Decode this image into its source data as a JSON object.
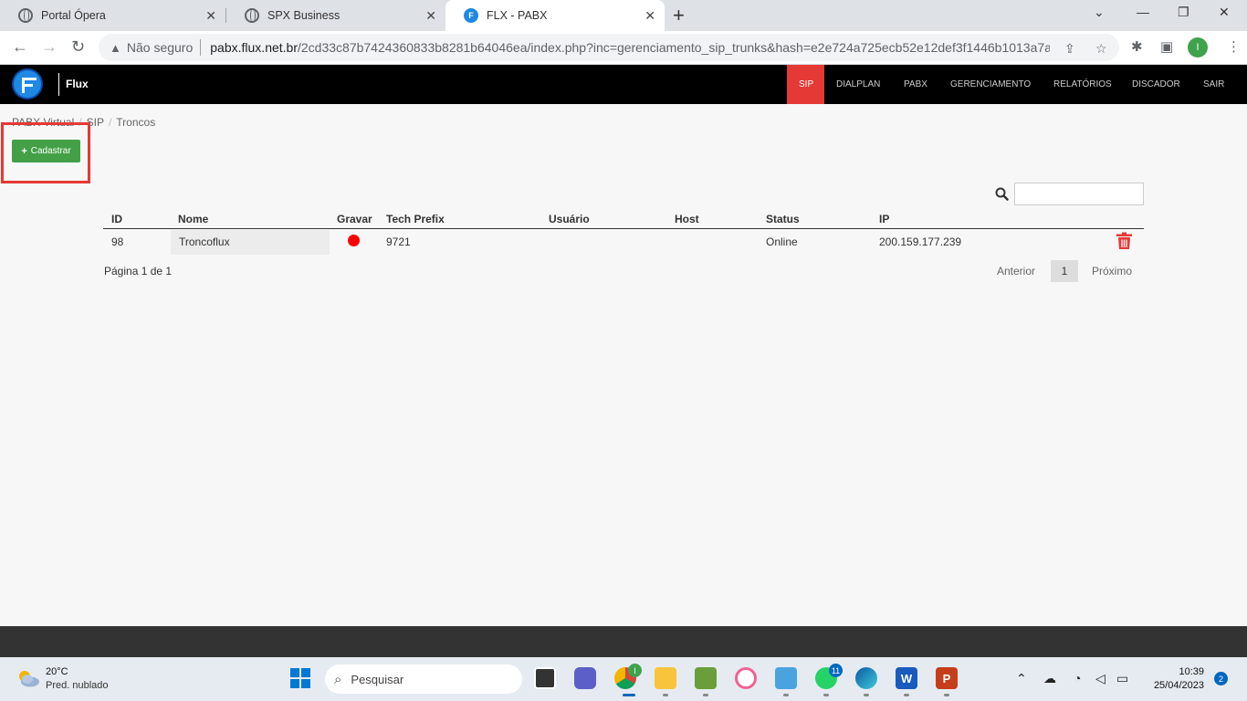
{
  "browser": {
    "tabs": [
      {
        "title": "Portal Ópera"
      },
      {
        "title": "SPX Business"
      },
      {
        "title": "FLX - PABX"
      }
    ],
    "security_label": "Não seguro",
    "url_domain": "pabx.flux.net.br",
    "url_path": "/2cd33c87b7424360833b8281b64046ea/index.php?inc=gerenciamento_sip_trunks&hash=e2e724a725ecb52e12def3f1446b1013a7a...",
    "profile_initial": "I"
  },
  "app": {
    "brand": "Flux",
    "nav": [
      "SIP",
      "DIALPLAN",
      "PABX",
      "GERENCIAMENTO",
      "RELATÓRIOS",
      "DISCADOR",
      "SAIR"
    ],
    "active_nav": "SIP"
  },
  "breadcrumb": [
    "PABX Virtual",
    "SIP",
    "Troncos"
  ],
  "actions": {
    "cadastrar": "Cadastrar"
  },
  "table": {
    "columns": [
      "ID",
      "Nome",
      "Gravar",
      "Tech Prefix",
      "Usuário",
      "Host",
      "Status",
      "IP"
    ],
    "rows": [
      {
        "id": "98",
        "nome": "Troncoflux",
        "gravar": "recording",
        "tech_prefix": "9721",
        "usuario": "",
        "host": "",
        "status": "Online",
        "ip": "200.159.177.239"
      }
    ]
  },
  "pagination": {
    "info": "Página 1 de 1",
    "prev": "Anterior",
    "current": "1",
    "next": "Próximo"
  },
  "taskbar": {
    "weather_temp": "20°C",
    "weather_desc": "Pred. nublado",
    "search_placeholder": "Pesquisar",
    "whatsapp_badge": "11",
    "time": "10:39",
    "date": "25/04/2023",
    "notifications": "2"
  },
  "colors": {
    "nav_active": "#e53935",
    "button_primary": "#43a047",
    "delete": "#e53935",
    "record_dot": "#ff0000"
  }
}
